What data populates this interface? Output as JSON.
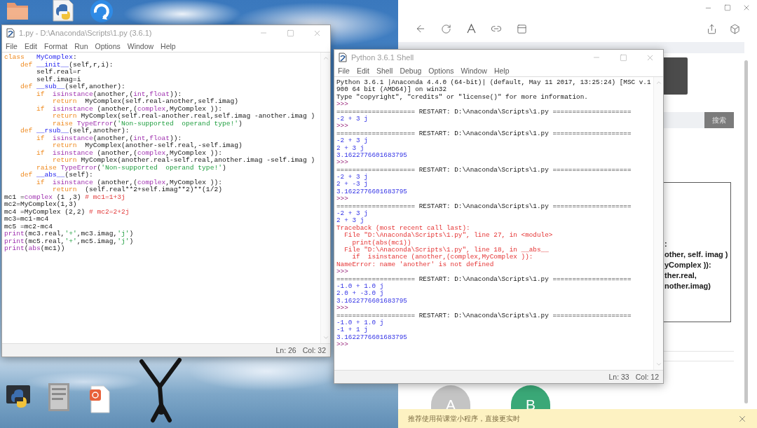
{
  "editor_window": {
    "title": "1.py - D:\\Anaconda\\Scripts\\1.py (3.6.1)",
    "menu": [
      "File",
      "Edit",
      "Format",
      "Run",
      "Options",
      "Window",
      "Help"
    ],
    "code_lines": [
      [
        {
          "kind": "keyword",
          "text": "class"
        },
        {
          "kind": "definition",
          "text": "   MyComplex"
        },
        {
          "kind": "plain",
          "text": ":"
        }
      ],
      [
        {
          "kind": "keyword",
          "text": "    def"
        },
        {
          "kind": "definition",
          "text": " __init__"
        },
        {
          "kind": "plain",
          "text": "(self,r,i):"
        }
      ],
      [
        {
          "kind": "plain",
          "text": "        self.real=r"
        }
      ],
      [
        {
          "kind": "plain",
          "text": "        self.imag=i"
        }
      ],
      [
        {
          "kind": "keyword",
          "text": "    def"
        },
        {
          "kind": "definition",
          "text": " __sub__"
        },
        {
          "kind": "plain",
          "text": "(self,another):"
        }
      ],
      [
        {
          "kind": "keyword",
          "text": "        if"
        },
        {
          "kind": "builtin",
          "text": "  isinstance"
        },
        {
          "kind": "plain",
          "text": "(another,("
        },
        {
          "kind": "builtin",
          "text": "int"
        },
        {
          "kind": "plain",
          "text": ","
        },
        {
          "kind": "builtin",
          "text": "float"
        },
        {
          "kind": "plain",
          "text": ")):"
        }
      ],
      [
        {
          "kind": "keyword",
          "text": "            return"
        },
        {
          "kind": "plain",
          "text": "  MyComplex(self.real-another,self.imag)"
        }
      ],
      [
        {
          "kind": "keyword",
          "text": "        if"
        },
        {
          "kind": "builtin",
          "text": "  isinstance"
        },
        {
          "kind": "plain",
          "text": " (another,("
        },
        {
          "kind": "builtin",
          "text": "complex"
        },
        {
          "kind": "plain",
          "text": ",MyComplex )):"
        }
      ],
      [
        {
          "kind": "keyword",
          "text": "            return"
        },
        {
          "kind": "plain",
          "text": " MyComplex(self.real-another.real,self.imag -another.imag )"
        }
      ],
      [
        {
          "kind": "keyword",
          "text": "            raise"
        },
        {
          "kind": "builtin",
          "text": " TypeError"
        },
        {
          "kind": "plain",
          "text": "("
        },
        {
          "kind": "string",
          "text": "'Non-supported  operand type!'"
        },
        {
          "kind": "plain",
          "text": ")"
        }
      ],
      [
        {
          "kind": "keyword",
          "text": "    def"
        },
        {
          "kind": "definition",
          "text": " __rsub__"
        },
        {
          "kind": "plain",
          "text": "(self,another):"
        }
      ],
      [
        {
          "kind": "keyword",
          "text": "        if"
        },
        {
          "kind": "builtin",
          "text": "  isinstance"
        },
        {
          "kind": "plain",
          "text": "(another,("
        },
        {
          "kind": "builtin",
          "text": "int"
        },
        {
          "kind": "plain",
          "text": ","
        },
        {
          "kind": "builtin",
          "text": "float"
        },
        {
          "kind": "plain",
          "text": ")):"
        }
      ],
      [
        {
          "kind": "keyword",
          "text": "            return"
        },
        {
          "kind": "plain",
          "text": "  MyComplex(another-self.real,-self.imag)"
        }
      ],
      [
        {
          "kind": "keyword",
          "text": "        if"
        },
        {
          "kind": "builtin",
          "text": "  isinstance"
        },
        {
          "kind": "plain",
          "text": " (another,("
        },
        {
          "kind": "builtin",
          "text": "complex"
        },
        {
          "kind": "plain",
          "text": ",MyComplex )):"
        }
      ],
      [
        {
          "kind": "keyword",
          "text": "            return"
        },
        {
          "kind": "plain",
          "text": " MyComplex(another.real-self.real,another.imag -self.imag )"
        }
      ],
      [
        {
          "kind": "keyword",
          "text": "        raise"
        },
        {
          "kind": "builtin",
          "text": " TypeError"
        },
        {
          "kind": "plain",
          "text": "("
        },
        {
          "kind": "string",
          "text": "'Non-supported  operand type!'"
        },
        {
          "kind": "plain",
          "text": ")"
        }
      ],
      [
        {
          "kind": "keyword",
          "text": "    def"
        },
        {
          "kind": "definition",
          "text": " __abs__"
        },
        {
          "kind": "plain",
          "text": "(self):"
        }
      ],
      [
        {
          "kind": "keyword",
          "text": "        if"
        },
        {
          "kind": "builtin",
          "text": "  isinstance"
        },
        {
          "kind": "plain",
          "text": " (another,("
        },
        {
          "kind": "builtin",
          "text": "complex"
        },
        {
          "kind": "plain",
          "text": ",MyComplex )):"
        }
      ],
      [
        {
          "kind": "keyword",
          "text": "            return"
        },
        {
          "kind": "plain",
          "text": "  (self.real**2+self.imag**2)**(1/2)"
        }
      ],
      [
        {
          "kind": "plain",
          "text": "mc1 ="
        },
        {
          "kind": "builtin",
          "text": "complex"
        },
        {
          "kind": "plain",
          "text": " (1 ,3) "
        },
        {
          "kind": "comment",
          "text": "# mc1=1+3j"
        }
      ],
      [
        {
          "kind": "plain",
          "text": "mc2=MyComplex(1,3)"
        }
      ],
      [
        {
          "kind": "plain",
          "text": "mc4 =MyComplex (2,2) "
        },
        {
          "kind": "comment",
          "text": "# mc2=2+2j"
        }
      ],
      [
        {
          "kind": "plain",
          "text": "mc3=mc1-mc4"
        }
      ],
      [
        {
          "kind": "plain",
          "text": "mc5 =mc2-mc4"
        }
      ],
      [
        {
          "kind": "builtin",
          "text": "print"
        },
        {
          "kind": "plain",
          "text": "(mc3.real,"
        },
        {
          "kind": "string",
          "text": "'+'"
        },
        {
          "kind": "plain",
          "text": ",mc3.imag,"
        },
        {
          "kind": "string",
          "text": "'j'"
        },
        {
          "kind": "plain",
          "text": ")"
        }
      ],
      [
        {
          "kind": "builtin",
          "text": "print"
        },
        {
          "kind": "plain",
          "text": "(mc5.real,"
        },
        {
          "kind": "string",
          "text": "'+'"
        },
        {
          "kind": "plain",
          "text": ",mc5.imag,"
        },
        {
          "kind": "string",
          "text": "'j'"
        },
        {
          "kind": "plain",
          "text": ")"
        }
      ],
      [
        {
          "kind": "builtin",
          "text": "print"
        },
        {
          "kind": "plain",
          "text": "("
        },
        {
          "kind": "builtin",
          "text": "abs"
        },
        {
          "kind": "plain",
          "text": "(mc1))"
        }
      ]
    ],
    "status": {
      "line": "Ln: 26",
      "column": "Col: 32"
    }
  },
  "shell_window": {
    "title": "Python 3.6.1 Shell",
    "menu": [
      "File",
      "Edit",
      "Shell",
      "Debug",
      "Options",
      "Window",
      "Help"
    ],
    "lines": [
      {
        "kind": "banner",
        "text": "Python 3.6.1 |Anaconda 4.4.0 (64-bit)| (default, May 11 2017, 13:25:24) [MSC v.1"
      },
      {
        "kind": "banner",
        "text": "900 64 bit (AMD64)] on win32"
      },
      {
        "kind": "banner",
        "text": "Type \"copyright\", \"credits\" or \"license()\" for more information."
      },
      {
        "kind": "prompt",
        "text": ">>>"
      },
      {
        "kind": "restart",
        "text": "==================== RESTART: D:\\Anaconda\\Scripts\\1.py ===================="
      },
      {
        "kind": "output",
        "text": "-2 + 3 j"
      },
      {
        "kind": "prompt",
        "text": ">>>"
      },
      {
        "kind": "restart",
        "text": "==================== RESTART: D:\\Anaconda\\Scripts\\1.py ===================="
      },
      {
        "kind": "output",
        "text": "-2 + 3 j"
      },
      {
        "kind": "output",
        "text": "2 + 3 j"
      },
      {
        "kind": "output",
        "text": "3.1622776601683795"
      },
      {
        "kind": "prompt",
        "text": ">>>"
      },
      {
        "kind": "restart",
        "text": "==================== RESTART: D:\\Anaconda\\Scripts\\1.py ===================="
      },
      {
        "kind": "output",
        "text": "-2 + 3 j"
      },
      {
        "kind": "output",
        "text": "2 + -3 j"
      },
      {
        "kind": "output",
        "text": "3.1622776601683795"
      },
      {
        "kind": "prompt",
        "text": ">>>"
      },
      {
        "kind": "restart",
        "text": "==================== RESTART: D:\\Anaconda\\Scripts\\1.py ===================="
      },
      {
        "kind": "output",
        "text": "-2 + 3 j"
      },
      {
        "kind": "output",
        "text": "2 + 3 j"
      },
      {
        "kind": "error",
        "text": "Traceback (most recent call last):"
      },
      {
        "kind": "error",
        "text": "  File \"D:\\Anaconda\\Scripts\\1.py\", line 27, in <module>"
      },
      {
        "kind": "error",
        "text": "    print(abs(mc1))"
      },
      {
        "kind": "error",
        "text": "  File \"D:\\Anaconda\\Scripts\\1.py\", line 18, in __abs__"
      },
      {
        "kind": "error",
        "text": "    if  isinstance (another,(complex,MyComplex )):"
      },
      {
        "kind": "error",
        "text": "NameError: name 'another' is not defined"
      },
      {
        "kind": "prompt",
        "text": ">>>"
      },
      {
        "kind": "restart",
        "text": "==================== RESTART: D:\\Anaconda\\Scripts\\1.py ===================="
      },
      {
        "kind": "output",
        "text": "-1.0 + 1.0 j"
      },
      {
        "kind": "output",
        "text": "2.0 + -3.0 j"
      },
      {
        "kind": "output",
        "text": "3.1622776601683795"
      },
      {
        "kind": "prompt",
        "text": ">>>"
      },
      {
        "kind": "restart",
        "text": "==================== RESTART: D:\\Anaconda\\Scripts\\1.py ===================="
      },
      {
        "kind": "output",
        "text": "-1.0 + 1.0 j"
      },
      {
        "kind": "output",
        "text": "-1 + 1 j"
      },
      {
        "kind": "output",
        "text": "3.1622776601683795"
      },
      {
        "kind": "prompt",
        "text": ">>>"
      }
    ],
    "status": {
      "line": "Ln: 33",
      "column": "Col: 12"
    }
  },
  "browser": {
    "search_button": "搜索",
    "article_lines": [
      ":",
      "other, self. imag )",
      "yComplex )):",
      "ther.real,",
      "nother.imag)"
    ],
    "avatars": [
      {
        "letter": "A",
        "color": "#c4c4c4"
      },
      {
        "letter": "B",
        "color": "#3aa877"
      }
    ],
    "notice": "推荐使用荷课堂小程序，直接更实时"
  }
}
